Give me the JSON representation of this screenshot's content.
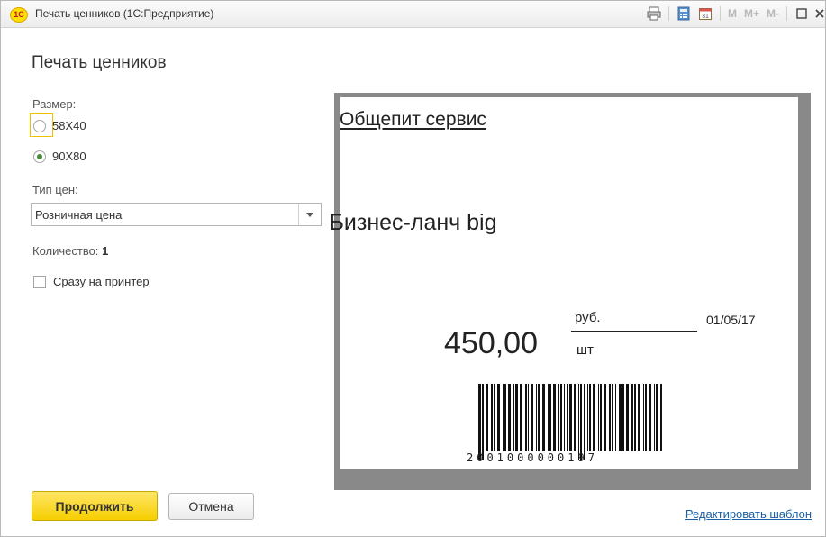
{
  "window": {
    "logo": "1С",
    "title": "Печать ценников  (1С:Предприятие)"
  },
  "toolbar": {
    "m_label": "M",
    "mplus_label": "M+",
    "mminus_label": "M-",
    "calendar_day": "31"
  },
  "form": {
    "title": "Печать ценников",
    "size_label": "Размер:",
    "size_options": [
      {
        "label": "58X40",
        "selected": false
      },
      {
        "label": "90X80",
        "selected": true
      }
    ],
    "price_type_label": "Тип цен:",
    "price_type_value": "Розничная цена",
    "quantity_label": "Количество:",
    "quantity_value": "1",
    "print_direct_label": "Сразу на принтер",
    "print_direct_checked": false
  },
  "preview": {
    "company": "Общепит сервис",
    "product": "Бизнес-ланч big",
    "price": "450,00",
    "currency": "руб.",
    "unit": "шт",
    "date": "01/05/17",
    "barcode_number": "2001000000197"
  },
  "buttons": {
    "continue": "Продолжить",
    "cancel": "Отмена"
  },
  "links": {
    "edit_template": "Редактировать шаблон"
  },
  "colors": {
    "primary_button": "#f5cf00",
    "link": "#1b5fa7",
    "preview_frame": "#898989",
    "focus": "#f0c000"
  }
}
